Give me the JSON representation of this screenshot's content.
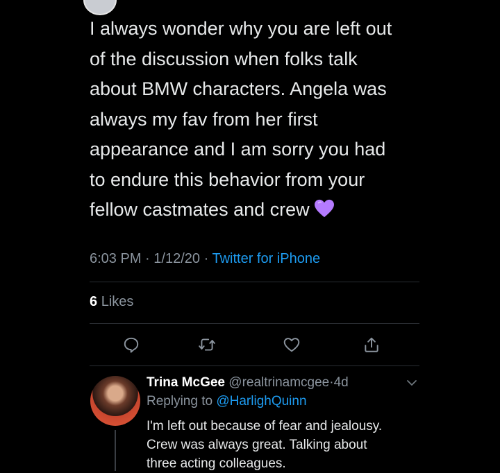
{
  "tweet": {
    "text_lines": [
      "I always wonder why you are left out",
      "of the discussion when folks talk",
      "about BMW characters. Angela was",
      "always my fav from her first",
      "appearance and I am sorry you had",
      "to endure this behavior from your",
      "fellow castmates and crew"
    ],
    "emoji": "purple-heart",
    "time": "6:03 PM",
    "date": "1/12/20",
    "source": "Twitter for iPhone",
    "likes_count": "6",
    "likes_label": "Likes"
  },
  "actions": [
    {
      "name": "reply",
      "icon": "comment-icon"
    },
    {
      "name": "retweet",
      "icon": "retweet-icon"
    },
    {
      "name": "like",
      "icon": "heart-icon"
    },
    {
      "name": "share",
      "icon": "share-icon"
    }
  ],
  "reply": {
    "display_name": "Trina McGee",
    "handle": "@realtrinamcgee",
    "age": "4d",
    "replying_to_label": "Replying to",
    "replying_to": "@HarlighQuinn",
    "text_lines": [
      "I'm left out because of fear and jealousy.",
      "Crew was always great. Talking about",
      "three acting colleagues."
    ]
  },
  "colors": {
    "background": "#000000",
    "text": "#e7e9ea",
    "muted": "#8b949e",
    "link": "#1d9bf0",
    "emoji": "#b57bff"
  }
}
